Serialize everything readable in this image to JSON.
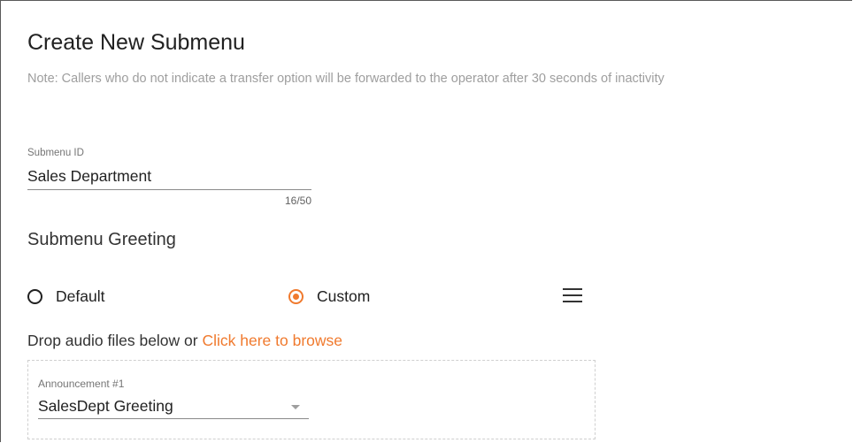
{
  "header": {
    "title": "Create New Submenu",
    "note": "Note: Callers who do not indicate a transfer option will be forwarded to the operator after 30 seconds of inactivity"
  },
  "submenu_id": {
    "label": "Submenu ID",
    "value": "Sales Department",
    "counter": "16/50"
  },
  "greeting": {
    "title": "Submenu Greeting",
    "options": [
      {
        "label": "Default",
        "checked": false
      },
      {
        "label": "Custom",
        "checked": true
      }
    ],
    "menu_icon": "hamburger-menu-icon"
  },
  "upload": {
    "prefix": "Drop audio files below or ",
    "link": "Click here to browse"
  },
  "announcement": {
    "label": "Announcement #1",
    "value": "SalesDept Greeting",
    "dropdown_icon": "caret-down-icon"
  },
  "colors": {
    "accent": "#f07a2e",
    "note_text": "#9e9e9e",
    "underline": "#8a8a8a"
  }
}
